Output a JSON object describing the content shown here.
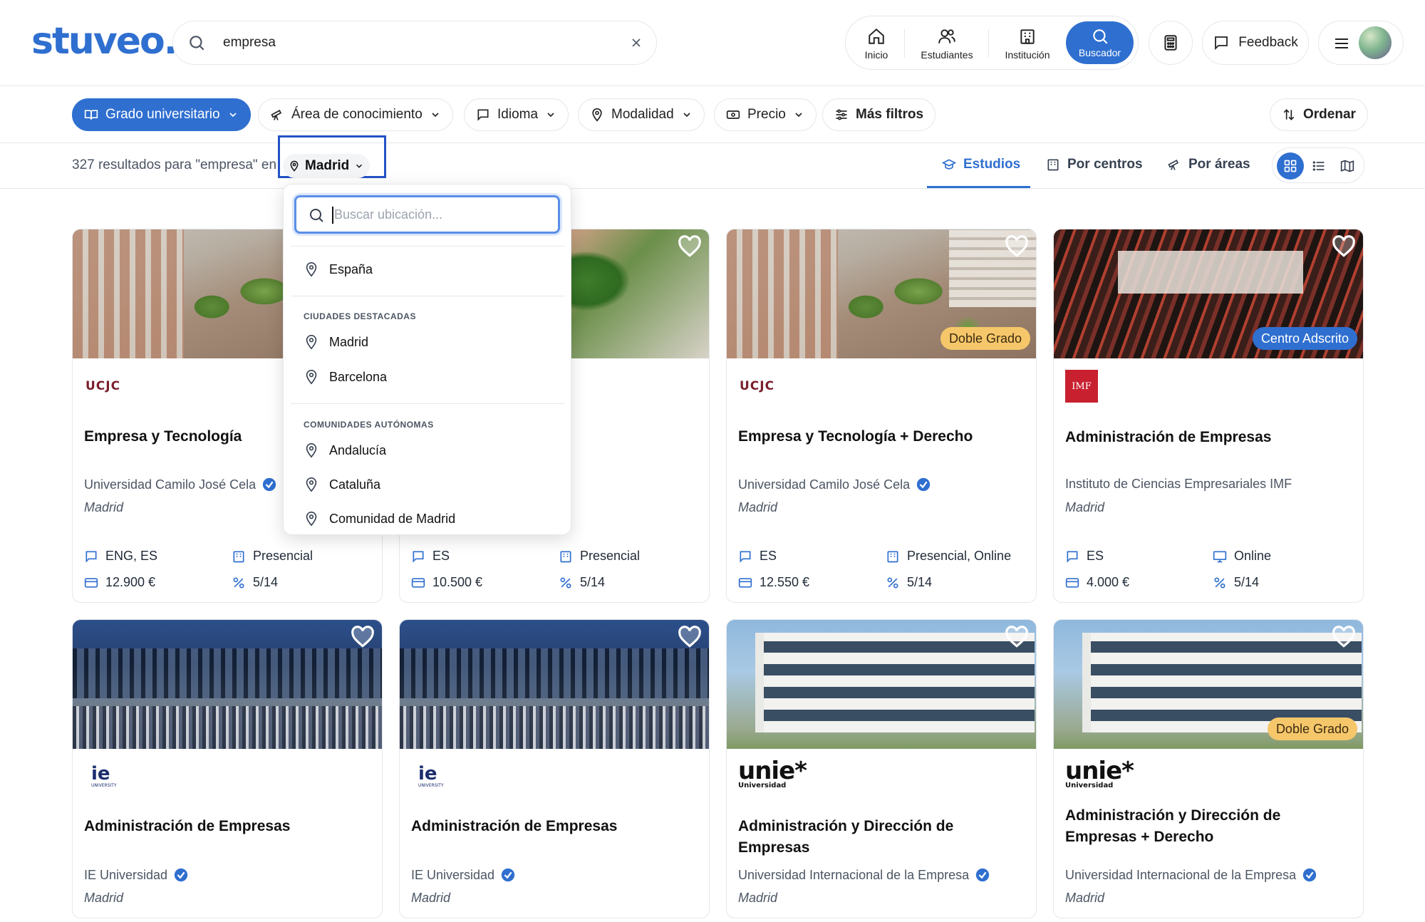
{
  "header": {
    "logo": "stuveo.",
    "search_value": "empresa",
    "nav": [
      {
        "label": "Inicio",
        "icon": "home-icon"
      },
      {
        "label": "Estudiantes",
        "icon": "users-icon"
      },
      {
        "label": "Institución",
        "icon": "building-icon"
      }
    ],
    "nav_active": {
      "label": "Buscador",
      "icon": "search-icon"
    },
    "feedback_label": "Feedback"
  },
  "filters": {
    "grado": "Grado universitario",
    "area": "Área de conocimiento",
    "idioma": "Idioma",
    "modalidad": "Modalidad",
    "precio": "Precio",
    "mas": "Más filtros",
    "ordenar": "Ordenar"
  },
  "results": {
    "summary": "327 resultados para \"empresa\" en",
    "location": "Madrid",
    "tabs": [
      "Estudios",
      "Por centros",
      "Por áreas"
    ],
    "active_tab": "Estudios"
  },
  "dropdown": {
    "placeholder": "Buscar ubicación...",
    "country": "España",
    "featured_header": "CIUDADES DESTACADAS",
    "featured": [
      "Madrid",
      "Barcelona"
    ],
    "regions_header": "COMUNIDADES AUTÓNOMAS",
    "regions": [
      "Andalucía",
      "Cataluña",
      "Comunidad de Madrid"
    ]
  },
  "cards": [
    {
      "logo": "UCJC",
      "title": "Empresa y Tecnología",
      "university": "Universidad Camilo José Cela",
      "city": "Madrid",
      "languages": "ENG, ES",
      "modality": "Presencial",
      "price": "12.900 €",
      "grade": "5/14",
      "badge": ""
    },
    {
      "logo": "",
      "title": "",
      "university": "",
      "city": "",
      "languages": "ES",
      "modality": "Presencial",
      "price": "10.500 €",
      "grade": "5/14",
      "badge": ""
    },
    {
      "logo": "UCJC",
      "title": "Empresa y Tecnología + Derecho",
      "university": "Universidad Camilo José Cela",
      "city": "Madrid",
      "languages": "ES",
      "modality": "Presencial, Online",
      "price": "12.550 €",
      "grade": "5/14",
      "badge": "Doble Grado"
    },
    {
      "logo": "IMF",
      "title": "Administración de Empresas",
      "university": "Instituto de Ciencias Empresariales IMF",
      "city": "Madrid",
      "languages": "ES",
      "modality": "Online",
      "price": "4.000 €",
      "grade": "5/14",
      "badge": "Centro Adscrito"
    },
    {
      "logo": "ie",
      "logo_sub": "UNIVERSITY",
      "title": "Administración de Empresas",
      "university": "IE Universidad",
      "city": "Madrid",
      "badge": ""
    },
    {
      "logo": "ie",
      "logo_sub": "UNIVERSITY",
      "title": "Administración de Empresas",
      "university": "IE Universidad",
      "city": "Madrid",
      "badge": ""
    },
    {
      "logo": "unie*",
      "logo_sub": "Universidad",
      "title": "Administración y Dirección de Empresas",
      "university": "Universidad Internacional de la Empresa",
      "city": "Madrid",
      "badge": ""
    },
    {
      "logo": "unie*",
      "logo_sub": "Universidad",
      "title": "Administración y Dirección de Empresas + Derecho",
      "university": "Universidad Internacional de la Empresa",
      "city": "Madrid",
      "badge": "Doble Grado"
    }
  ],
  "colors": {
    "accent": "#2f6fd0",
    "badge_doble": "#f6c76a",
    "highlight_box": "#2452c6"
  }
}
